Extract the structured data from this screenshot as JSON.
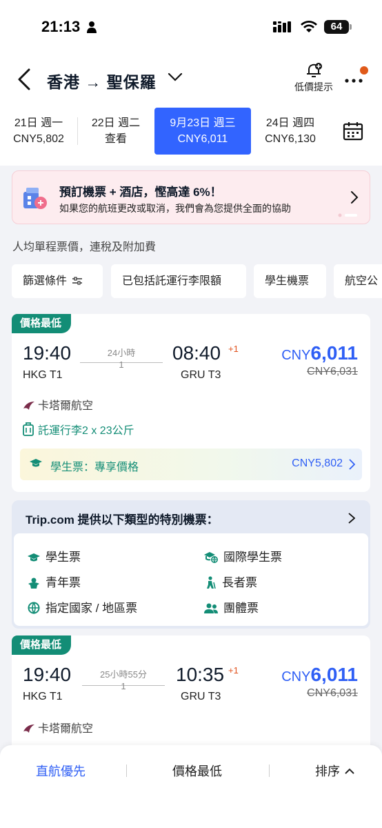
{
  "status_bar": {
    "time": "21:13",
    "battery": "64"
  },
  "header": {
    "route": "香港 → 聖保羅",
    "alert_label": "低價提示"
  },
  "dates": [
    {
      "day": "21日 週一",
      "price": "CNY5,802"
    },
    {
      "day": "22日 週二",
      "price": "查看"
    },
    {
      "day": "9月23日 週三",
      "price": "CNY6,011"
    },
    {
      "day": "24日 週四",
      "price": "CNY6,130"
    }
  ],
  "promo": {
    "title": "預訂機票 + 酒店，慳高達 6%！",
    "subtitle": "如果您的航班更改或取消，我們會為您提供全面的協助"
  },
  "note": "人均單程票價，連稅及附加費",
  "filters": [
    "篩選條件",
    "已包括託運行李限額",
    "學生機票",
    "航空公"
  ],
  "flights": [
    {
      "tag": "價格最低",
      "dep_time": "19:40",
      "dep_airport": "HKG T1",
      "duration": "24小時",
      "stops": "1",
      "arr_time": "08:40",
      "day_offset": "+1",
      "arr_airport": "GRU T3",
      "currency": "CNY",
      "price": "6,011",
      "old_price": "CNY6,031",
      "airline": "卡塔爾航空",
      "baggage": "託運行李2 x 23公斤",
      "student_label": "學生票：專享價格",
      "student_price": "CNY5,802"
    },
    {
      "tag": "價格最低",
      "dep_time": "19:40",
      "dep_airport": "HKG T1",
      "duration": "25小時55分",
      "stops": "1",
      "arr_time": "10:35",
      "day_offset": "+1",
      "arr_airport": "GRU T3",
      "currency": "CNY",
      "price": "6,011",
      "old_price": "CNY6,031",
      "airline": "卡塔爾航空"
    }
  ],
  "special": {
    "title": "Trip.com 提供以下類型的特別機票：",
    "items": [
      "學生票",
      "國際學生票",
      "青年票",
      "長者票",
      "指定國家 / 地區票",
      "團體票"
    ]
  },
  "bottom_bar": {
    "nonstop": "直航優先",
    "cheapest": "價格最低",
    "sort": "排序"
  },
  "colors": {
    "accent": "#3264ff",
    "tag_green": "#138d76",
    "price_blue": "#2f5ff5",
    "alert_red": "#e0501b"
  }
}
